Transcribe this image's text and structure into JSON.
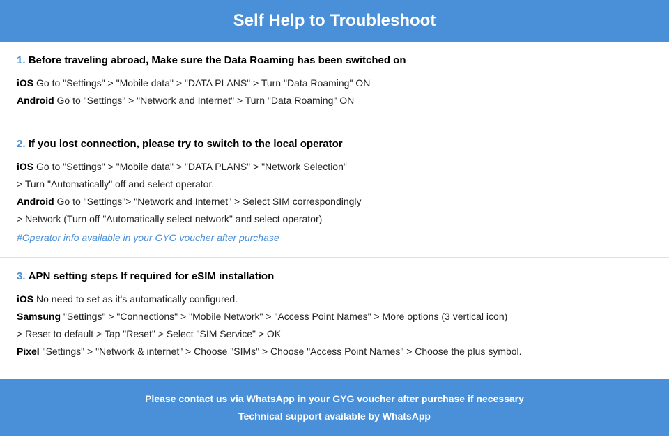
{
  "header": {
    "title": "Self Help to Troubleshoot"
  },
  "sections": [
    {
      "number": "1.",
      "title": "Before traveling abroad, Make sure the Data Roaming has been switched on",
      "instructions": [
        {
          "platform": "iOS",
          "text": "Go to \"Settings\" > \"Mobile data\" > \"DATA PLANS\" > Turn \"Data Roaming\" ON",
          "continuation": null
        },
        {
          "platform": "Android",
          "text": "Go to \"Settings\" > \"Network and Internet\" > Turn \"Data Roaming\" ON",
          "continuation": null
        }
      ],
      "note": null
    },
    {
      "number": "2.",
      "title": "If you lost connection, please try to switch to the local operator",
      "instructions": [
        {
          "platform": "iOS",
          "text": "Go to \"Settings\" > \"Mobile data\" > \"DATA PLANS\" > \"Network Selection\"",
          "continuation": "> Turn \"Automatically\" off and select operator."
        },
        {
          "platform": "Android",
          "text": "Go to \"Settings\">  \"Network and Internet\" > Select SIM correspondingly",
          "continuation": "> Network (Turn off \"Automatically select network\" and select operator)"
        }
      ],
      "note": "#Operator info available in your GYG voucher after purchase"
    },
    {
      "number": "3.",
      "title": "APN setting steps If required for eSIM installation",
      "instructions": [
        {
          "platform": "iOS",
          "text": "No need to set as it's automatically configured.",
          "continuation": null
        },
        {
          "platform": "Samsung",
          "text": "\"Settings\" > \"Connections\" > \"Mobile Network\" > \"Access Point Names\" > More options (3 vertical icon)",
          "continuation": "> Reset to default > Tap \"Reset\" > Select \"SIM Service\" > OK"
        },
        {
          "platform": "Pixel",
          "text": "\"Settings\" > \"Network & internet\" > Choose \"SIMs\" > Choose \"Access Point Names\" > Choose the plus symbol.",
          "continuation": null
        }
      ],
      "note": null
    }
  ],
  "footer": {
    "line1": "Please contact us via WhatsApp  in your GYG voucher after purchase if necessary",
    "line2": "Technical support available by WhatsApp"
  }
}
